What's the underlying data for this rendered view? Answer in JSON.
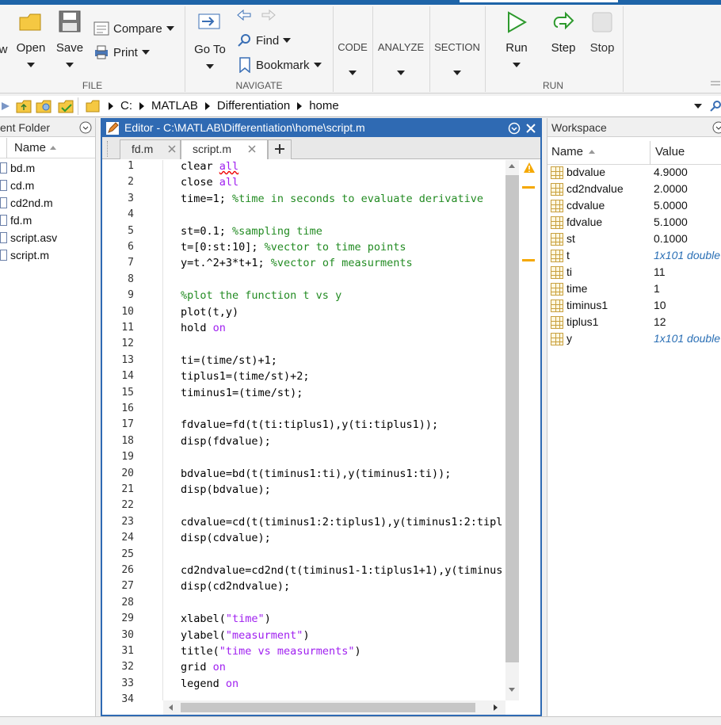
{
  "toolstrip": {
    "file": {
      "new_label": "w",
      "open_label": "Open",
      "save_label": "Save",
      "compare_label": "Compare",
      "print_label": "Print",
      "group_label": "FILE"
    },
    "navigate": {
      "goto_label": "Go To",
      "find_label": "Find",
      "bookmark_label": "Bookmark",
      "group_label": "NAVIGATE"
    },
    "code_label": "CODE",
    "analyze_label": "ANALYZE",
    "section_label": "SECTION",
    "run": {
      "run_label": "Run",
      "step_label": "Step",
      "stop_label": "Stop",
      "group_label": "RUN"
    }
  },
  "address": {
    "crumbs": [
      "C:",
      "MATLAB",
      "Differentiation",
      "home"
    ]
  },
  "current_folder": {
    "title": "ent Folder",
    "column_name": "Name",
    "files": [
      "bd.m",
      "cd.m",
      "cd2nd.m",
      "fd.m",
      "script.asv",
      "script.m"
    ]
  },
  "editor": {
    "title": "Editor - C:\\MATLAB\\Differentiation\\home\\script.m",
    "tabs": [
      "fd.m",
      "script.m"
    ],
    "active_tab": "script.m",
    "line_numbers": [
      "1",
      "2",
      "3",
      "4",
      "5",
      "6",
      "7",
      "8",
      "9",
      "10",
      "11",
      "12",
      "13",
      "14",
      "15",
      "16",
      "17",
      "18",
      "19",
      "20",
      "21",
      "22",
      "23",
      "24",
      "25",
      "26",
      "27",
      "28",
      "29",
      "30",
      "31",
      "32",
      "33",
      "34"
    ]
  },
  "workspace": {
    "title": "Workspace",
    "col_name": "Name",
    "col_value": "Value",
    "vars": [
      {
        "name": "bdvalue",
        "value": "4.9000"
      },
      {
        "name": "cd2ndvalue",
        "value": "2.0000"
      },
      {
        "name": "cdvalue",
        "value": "5.0000"
      },
      {
        "name": "fdvalue",
        "value": "5.1000"
      },
      {
        "name": "st",
        "value": "0.1000"
      },
      {
        "name": "t",
        "value": "1x101 double"
      },
      {
        "name": "ti",
        "value": "11"
      },
      {
        "name": "time",
        "value": "1"
      },
      {
        "name": "timinus1",
        "value": "10"
      },
      {
        "name": "tiplus1",
        "value": "12"
      },
      {
        "name": "y",
        "value": "1x101 double"
      }
    ]
  },
  "code": {
    "l1a": "clear ",
    "l1b": "all",
    "l2a": "close ",
    "l2b": "all",
    "l3a": "time=1; ",
    "l3b": "%time in seconds to evaluate derivative",
    "l5a": "st=0.1; ",
    "l5b": "%sampling time",
    "l6a": "t=[0:st:10]; ",
    "l6b": "%vector to time points",
    "l7a": "y=t.^2+3*t+1; ",
    "l7b": "%vector of measurments",
    "l9": "%plot the function t vs y",
    "l10": "plot(t,y)",
    "l11a": "hold ",
    "l11b": "on",
    "l13": "ti=(time/st)+1;",
    "l14": "tiplus1=(time/st)+2;",
    "l15": "timinus1=(time/st);",
    "l17": "fdvalue=fd(t(ti:tiplus1),y(ti:tiplus1));",
    "l18": "disp(fdvalue);",
    "l20": "bdvalue=bd(t(timinus1:ti),y(timinus1:ti));",
    "l21": "disp(bdvalue);",
    "l23": "cdvalue=cd(t(timinus1:2:tiplus1),y(timinus1:2:tipl",
    "l24": "disp(cdvalue);",
    "l26": "cd2ndvalue=cd2nd(t(timinus1-1:tiplus1+1),y(timinus",
    "l27": "disp(cd2ndvalue);",
    "l29a": "xlabel(",
    "l29b": "\"time\"",
    "l29c": ")",
    "l30a": "ylabel(",
    "l30b": "\"measurment\"",
    "l30c": ")",
    "l31a": "title(",
    "l31b": "\"time vs measurments\"",
    "l31c": ")",
    "l32a": "grid ",
    "l32b": "on",
    "l33a": "legend ",
    "l33b": "on"
  }
}
